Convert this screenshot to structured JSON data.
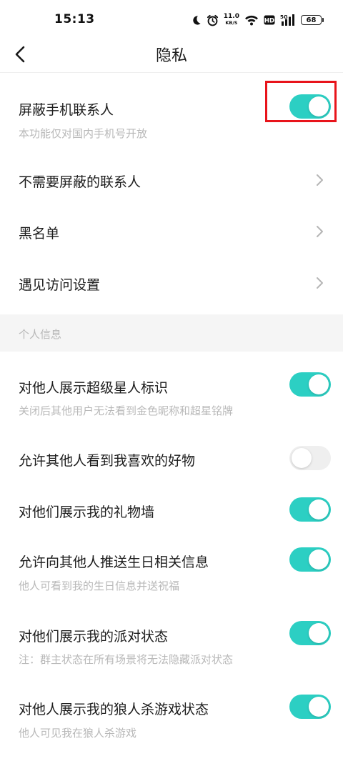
{
  "status_bar": {
    "time": "15:13",
    "net_speed_value": "11.0",
    "net_speed_unit": "KB/S",
    "hd_label": "HD",
    "signal_label": "5G",
    "battery": "68",
    "icons": [
      "moon-icon",
      "alarm-icon",
      "wifi-icon",
      "hd-icon",
      "signal-icon",
      "battery-icon"
    ]
  },
  "header": {
    "back_icon": "chevron-left-icon",
    "title": "隐私"
  },
  "block_contacts": {
    "label": "屏蔽手机联系人",
    "sub": "本功能仅对国内手机号开放",
    "enabled": true
  },
  "nav_items": [
    {
      "label": "不需要屏蔽的联系人",
      "icon": "chevron-right-icon"
    },
    {
      "label": "黑名单",
      "icon": "chevron-right-icon"
    },
    {
      "label": "遇见访问设置",
      "icon": "chevron-right-icon"
    }
  ],
  "section": {
    "title": "个人信息"
  },
  "toggles": [
    {
      "label": "对他人展示超级星人标识",
      "sub": "关闭后其他用户无法看到金色昵称和超星铭牌",
      "enabled": true
    },
    {
      "label": "允许其他人看到我喜欢的好物",
      "sub": "",
      "enabled": false
    },
    {
      "label": "对他们展示我的礼物墙",
      "sub": "",
      "enabled": true
    },
    {
      "label": "允许向其他人推送生日相关信息",
      "sub": "他人可看到我的生日信息并送祝福",
      "enabled": true
    },
    {
      "label": "对他们展示我的派对状态",
      "sub": "注：群主状态在所有场景将无法隐藏派对状态",
      "enabled": true
    },
    {
      "label": "对他人展示我的狼人杀游戏状态",
      "sub": "他人可见我在狼人杀游戏",
      "enabled": true
    }
  ],
  "colors": {
    "toggle_on": "#2ccfc3",
    "toggle_off": "#efefef",
    "highlight": "#e8141b",
    "subtext": "#b8b8b8",
    "section_bg": "#f5f5f5"
  }
}
